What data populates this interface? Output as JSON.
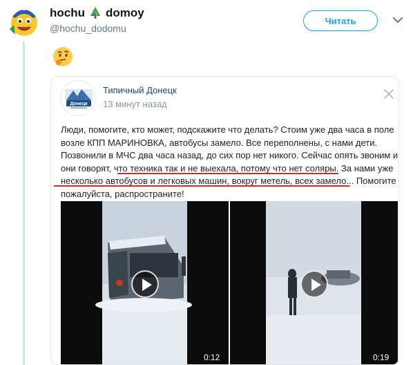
{
  "tweet": {
    "display_name": "hochu",
    "display_name_suffix": "domoy",
    "name_emoji": "christmas-tree",
    "handle": "@hochu_dodomu",
    "follow_label": "Читать",
    "reaction_emoji": "thinking-face"
  },
  "card": {
    "author": "Типичный Донецк",
    "avatar_text": "Донецк",
    "time": "13 минут назад",
    "lines": [
      "Люди, помогите, кто может, подскажите что делать? Стоим уже два часа в поле",
      "возле КПП МАРИНОВКА, автобусы замело. Все переполнены, с нами дети.",
      "Позвонили в МЧС два часа назад, до сих пор нет никого. Сейчас опять звоним и",
      "они говорят, что техника так и не выехала, потому что нет соляры. За нами уже",
      "несколько автобусов и легковых машин, вокруг метель, всех замело... Помогите",
      "пожалуйста, распространите!"
    ]
  },
  "videos": [
    {
      "duration": "0:12"
    },
    {
      "duration": "0:19"
    }
  ],
  "colors": {
    "accent": "#1da1f2",
    "thread_line": "#cce7f7",
    "highlight": "#d8282a",
    "card_name": "#1c4a7a"
  }
}
